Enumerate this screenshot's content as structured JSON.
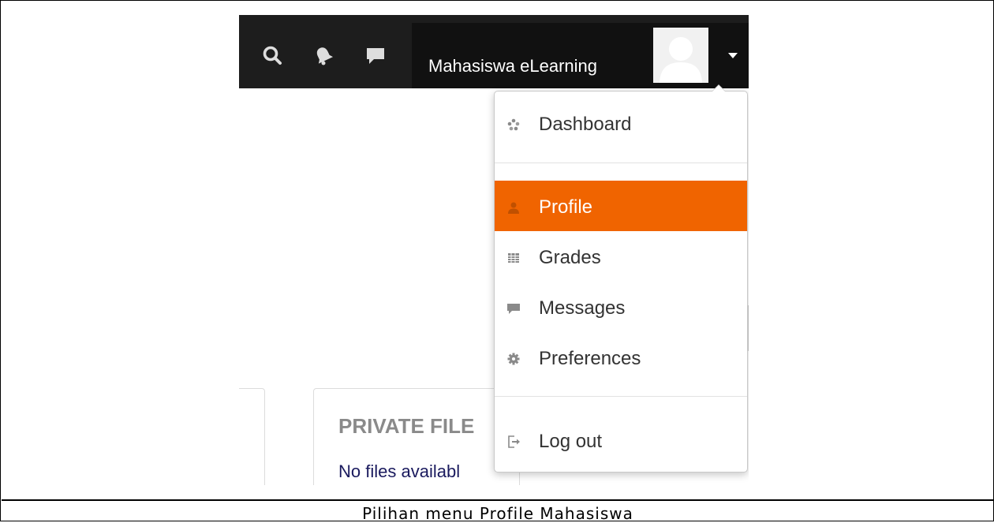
{
  "navbar": {
    "icons": [
      "search-icon",
      "bell-icon",
      "message-icon"
    ],
    "user_name": "Mahasiswa eLearning"
  },
  "user_menu": {
    "items": [
      {
        "label": "Dashboard",
        "icon": "dashboard-icon"
      },
      {
        "label": "Profile",
        "icon": "user-icon",
        "active": true
      },
      {
        "label": "Grades",
        "icon": "grades-icon"
      },
      {
        "label": "Messages",
        "icon": "message-icon"
      },
      {
        "label": "Preferences",
        "icon": "gear-icon"
      },
      {
        "label": "Log out",
        "icon": "logout-icon"
      }
    ],
    "active_color": "#f06400"
  },
  "content": {
    "card_title": "PRIVATE FILE",
    "card_text": "No files availabl"
  },
  "caption": "Pilihan menu Profile Mahasiswa"
}
